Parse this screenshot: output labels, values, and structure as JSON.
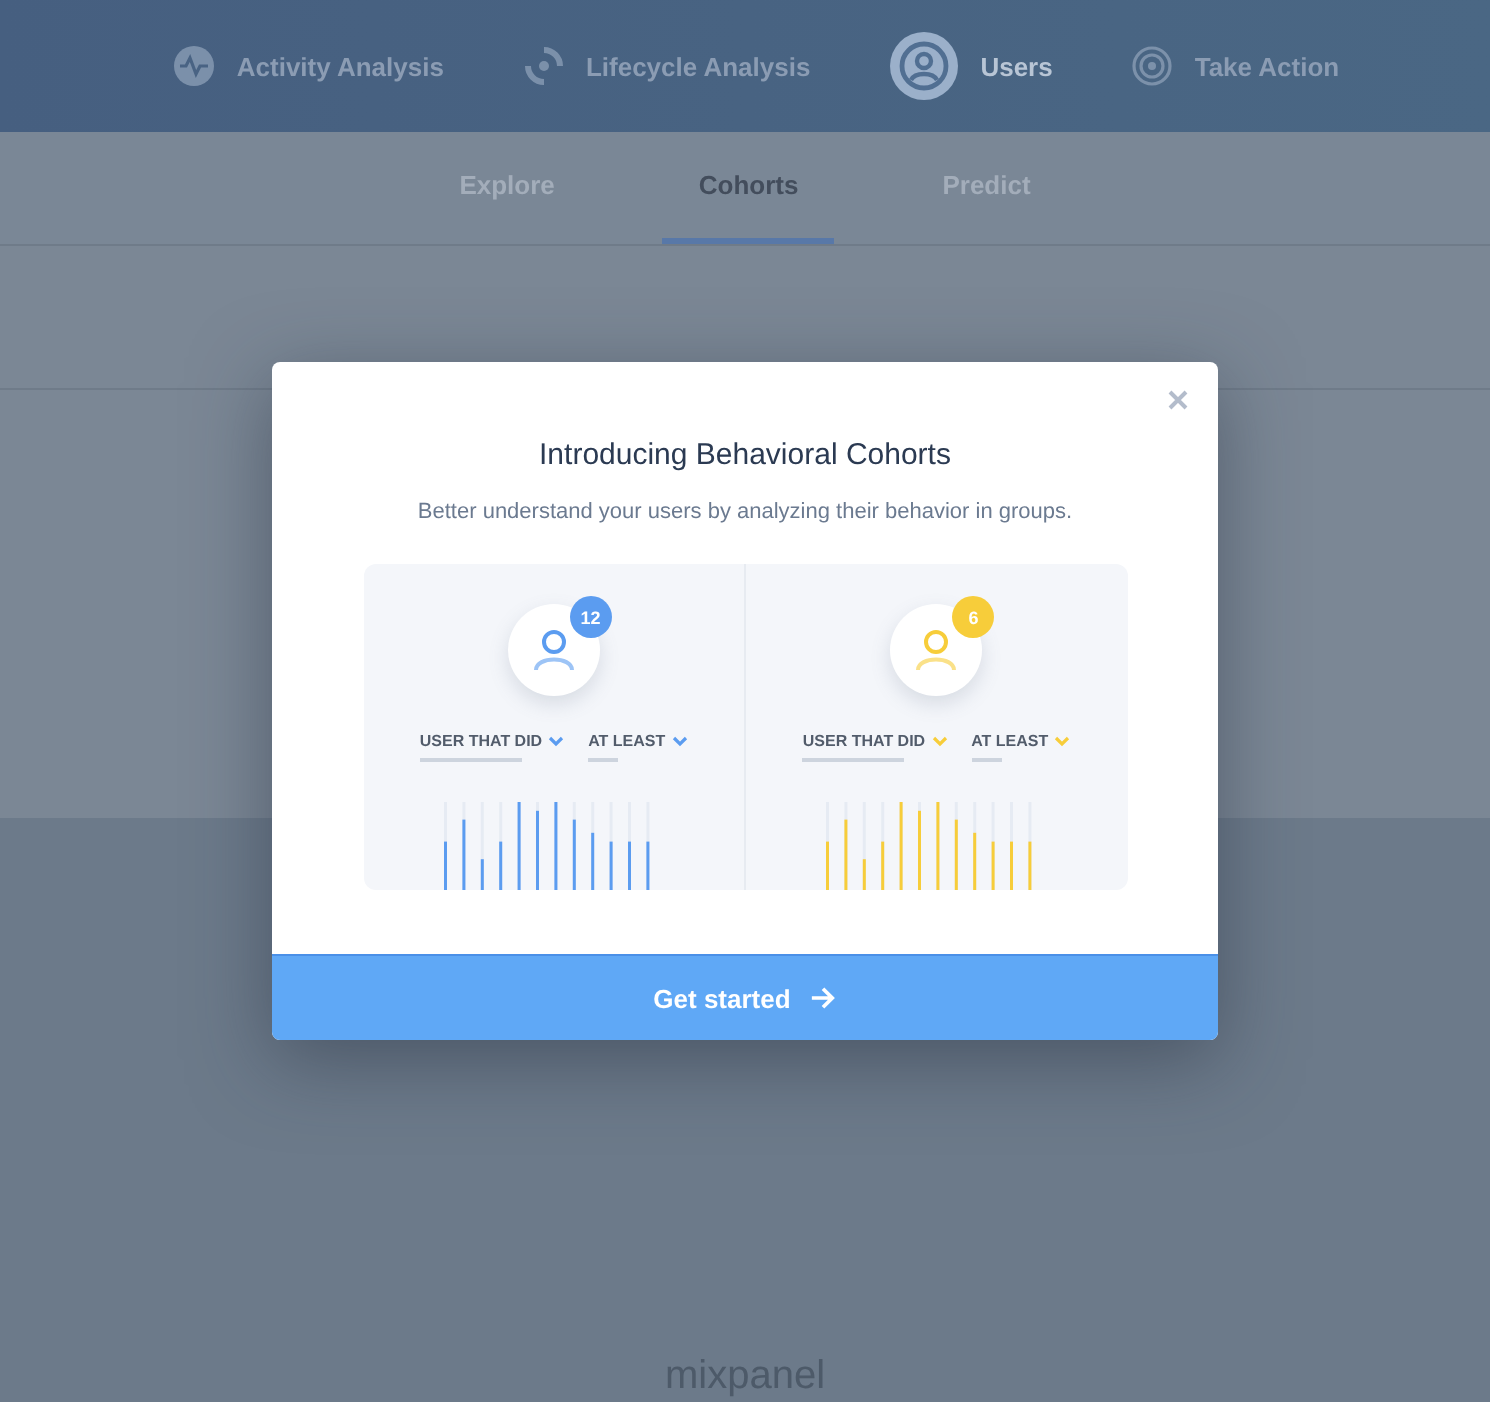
{
  "top_nav": [
    {
      "label": "Activity Analysis",
      "selected": false
    },
    {
      "label": "Lifecycle Analysis",
      "selected": false
    },
    {
      "label": "Users",
      "selected": true
    },
    {
      "label": "Take Action",
      "selected": false
    }
  ],
  "sub_tabs": [
    {
      "label": "Explore",
      "selected": false
    },
    {
      "label": "Cohorts",
      "selected": true
    },
    {
      "label": "Predict",
      "selected": false
    }
  ],
  "modal": {
    "title": "Introducing Behavioral Cohorts",
    "subtitle": "Better understand your users by analyzing their behavior in groups.",
    "cohort_panels": [
      {
        "count": "12",
        "color": "#5b9cf0",
        "filters": [
          "USER THAT DID",
          "AT LEAST"
        ]
      },
      {
        "count": "6",
        "color": "#f7cd3a",
        "filters": [
          "USER THAT DID",
          "AT LEAST"
        ]
      }
    ],
    "button": "Get started"
  },
  "footer": {
    "logo": "mixpanel"
  }
}
